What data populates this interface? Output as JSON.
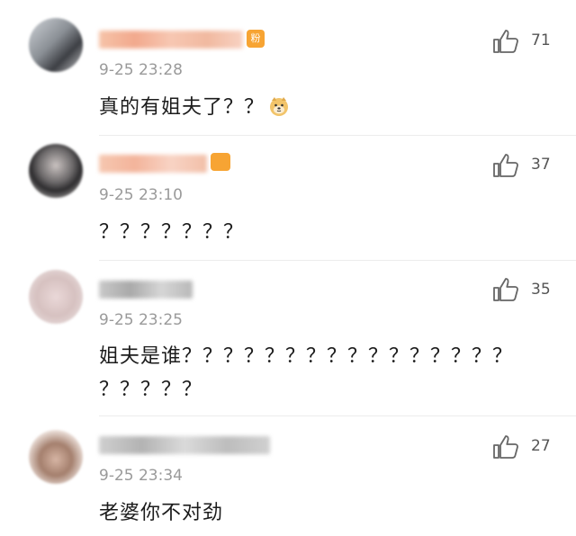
{
  "comments": [
    {
      "timestamp": "9-25 23:28",
      "text": "真的有姐夫了？？",
      "likes": "71",
      "badge": "粉",
      "emoji": "doge-emoji"
    },
    {
      "timestamp": "9-25 23:10",
      "text": "？？？？？？？",
      "likes": "37"
    },
    {
      "timestamp": "9-25 23:25",
      "text": "姐夫是谁？？？？？？？？？？？？？？？？",
      "text_line2": "？？？？？",
      "likes": "35"
    },
    {
      "timestamp": "9-25 23:34",
      "text": "老婆你不对劲",
      "likes": "27"
    }
  ],
  "colors": {
    "badge_orange": "#f7a433",
    "muted": "#9a9a9a",
    "text": "#1c1c1c"
  }
}
